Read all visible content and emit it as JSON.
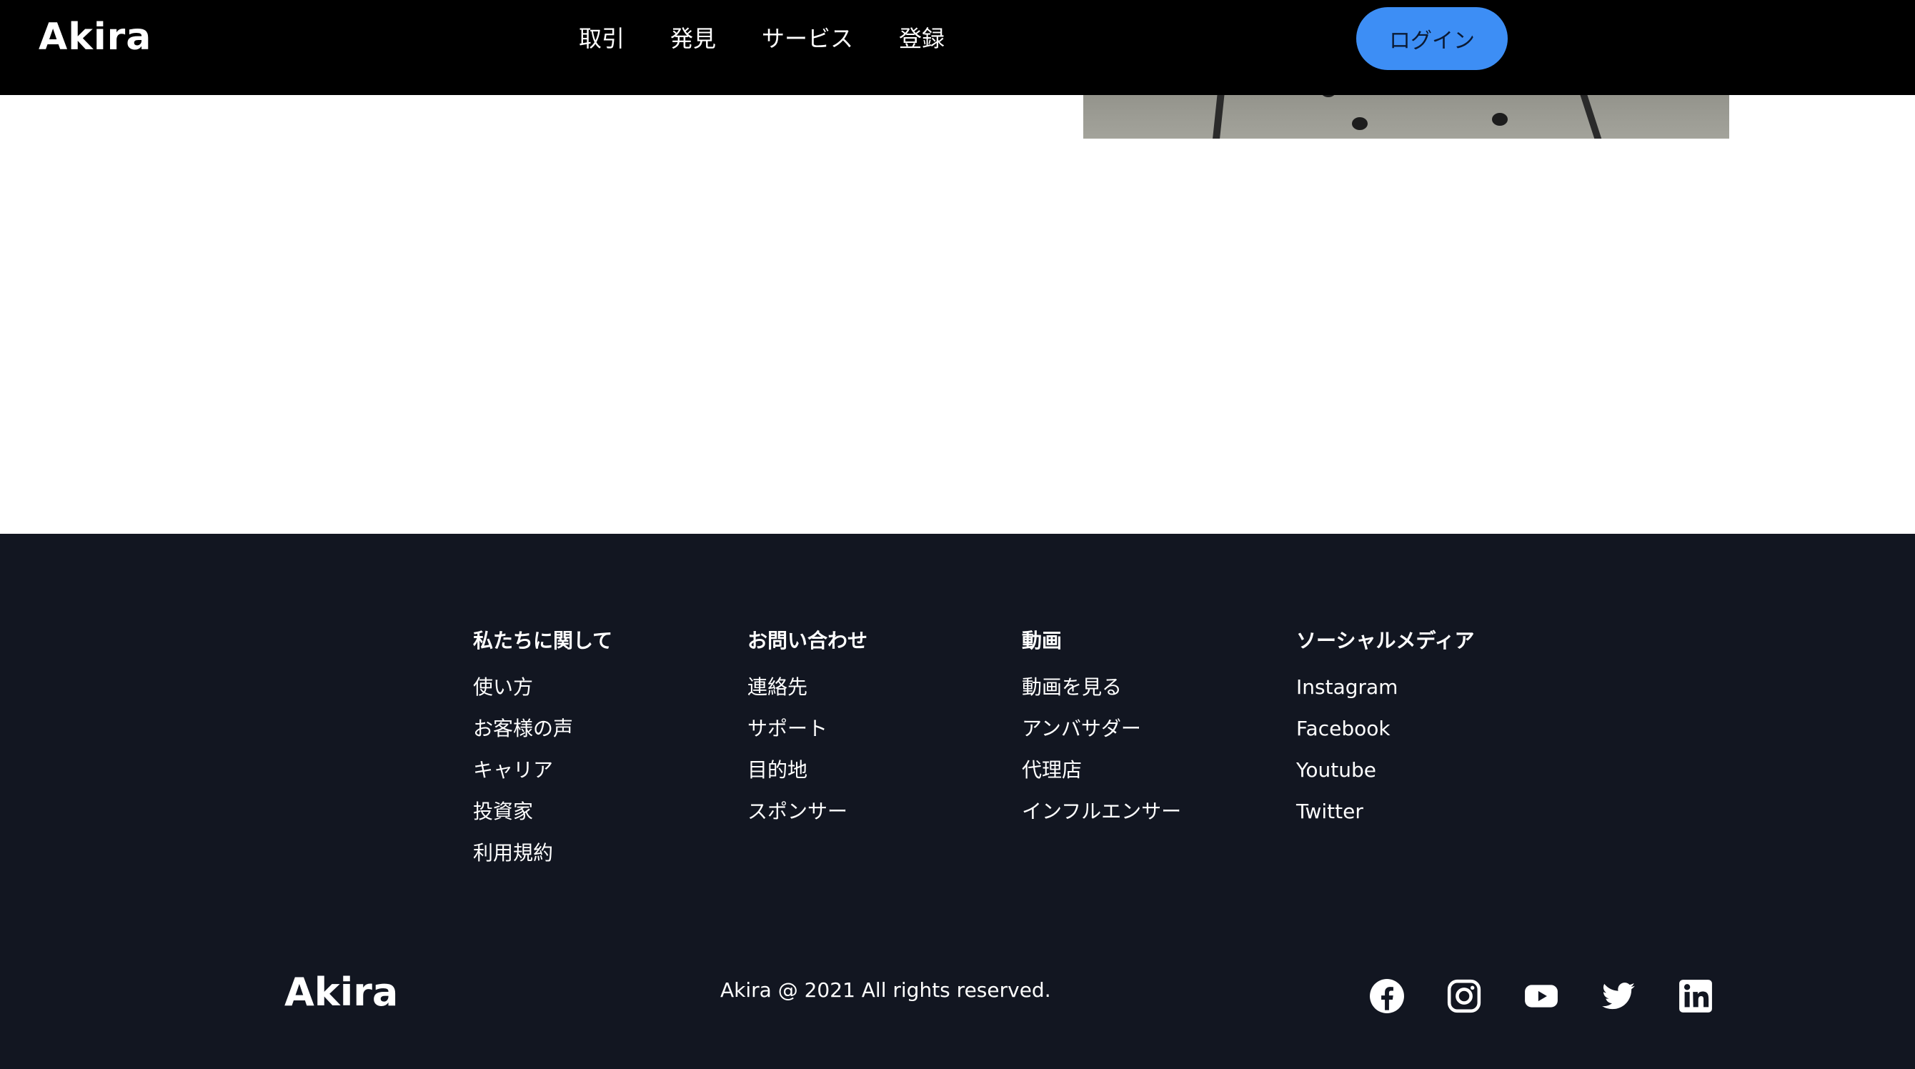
{
  "header": {
    "logo": "Akira",
    "nav": [
      "取引",
      "発見",
      "サービス",
      "登録"
    ],
    "login_label": "ログイン",
    "login_color": "#3d8ef5"
  },
  "footer": {
    "background": "#121621",
    "columns": [
      {
        "title": "私たちに関して",
        "links": [
          "使い方",
          "お客様の声",
          "キャリア",
          "投資家",
          "利用規約"
        ]
      },
      {
        "title": "お問い合わせ",
        "links": [
          "連絡先",
          "サポート",
          "目的地",
          "スポンサー"
        ]
      },
      {
        "title": "動画",
        "links": [
          "動画を見る",
          "アンバサダー",
          "代理店",
          "インフルエンサー"
        ]
      },
      {
        "title": "ソーシャルメディア",
        "links": [
          "Instagram",
          "Facebook",
          "Youtube",
          "Twitter"
        ]
      }
    ],
    "logo": "Akira",
    "copyright": "Akira @ 2021 All rights reserved.",
    "social_icons": [
      "facebook-icon",
      "instagram-icon",
      "youtube-icon",
      "twitter-icon",
      "linkedin-icon"
    ]
  }
}
